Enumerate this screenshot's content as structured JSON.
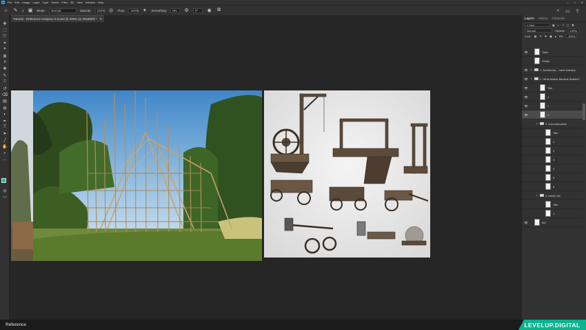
{
  "app": {
    "menu": [
      "File",
      "Edit",
      "Image",
      "Layer",
      "Type",
      "Select",
      "Filter",
      "3D",
      "View",
      "Window",
      "Help"
    ],
    "window_controls": [
      "–",
      "□",
      "✕"
    ]
  },
  "options_bar": {
    "brush_size": "1",
    "mode_label": "Mode:",
    "mode_value": "Normal",
    "opacity_label": "Opacity:",
    "opacity_value": "100%",
    "flow_label": "Flow:",
    "flow_value": "100%",
    "smoothing_label": "Smoothing:",
    "smoothing_value": "0%",
    "angle_value": "0°"
  },
  "document": {
    "tab_title": "Tutorial - Reference Analysys 2.0.psd @ 200% (3, RGB/8#) *",
    "close_glyph": "✕"
  },
  "colors": {
    "foreground": "#12c4a0",
    "background": "#ffffff",
    "brand": "#0bb38e"
  },
  "layers_panel": {
    "tabs": [
      "Layers",
      "History",
      "Channels"
    ],
    "filter_label": "Kind",
    "blend_mode": "Normal",
    "opacity_label": "Opacity:",
    "opacity_value": "100%",
    "lock_label": "Lock:",
    "fill_label": "Fill:",
    "fill_value": "100%",
    "layers": [
      {
        "name": "Topic",
        "kind": "thumb",
        "depth": 0,
        "visible": true,
        "selected": false
      },
      {
        "name": "Points",
        "kind": "thumb",
        "depth": 0,
        "visible": false,
        "selected": false
      },
      {
        "name": "1. Architectur... ment Industry",
        "kind": "folder",
        "depth": 0,
        "visible": true,
        "selected": false,
        "expanded": false
      },
      {
        "name": "2. What Makes Medical Stables?",
        "kind": "folder",
        "depth": 0,
        "visible": true,
        "selected": false,
        "expanded": true
      },
      {
        "name": "Title",
        "kind": "thumb",
        "depth": 1,
        "visible": true,
        "selected": false
      },
      {
        "name": "1",
        "kind": "thumb",
        "depth": 1,
        "visible": true,
        "selected": false
      },
      {
        "name": "2",
        "kind": "thumb",
        "depth": 1,
        "visible": true,
        "selected": false
      },
      {
        "name": "3",
        "kind": "thumb",
        "depth": 1,
        "visible": true,
        "selected": true
      },
      {
        "name": "3. Deconstruction",
        "kind": "folder",
        "depth": 1,
        "visible": false,
        "selected": false,
        "expanded": true
      },
      {
        "name": "Title",
        "kind": "thumb",
        "depth": 2,
        "visible": false,
        "selected": false
      },
      {
        "name": "1",
        "kind": "thumb",
        "depth": 2,
        "visible": false,
        "selected": false
      },
      {
        "name": "2",
        "kind": "thumb",
        "depth": 2,
        "visible": false,
        "selected": false
      },
      {
        "name": "3",
        "kind": "thumb",
        "depth": 2,
        "visible": false,
        "selected": false
      },
      {
        "name": "4",
        "kind": "thumb",
        "depth": 2,
        "visible": false,
        "selected": false
      },
      {
        "name": "5",
        "kind": "thumb",
        "depth": 2,
        "visible": false,
        "selected": false
      },
      {
        "name": "6",
        "kind": "thumb",
        "depth": 2,
        "visible": false,
        "selected": false
      },
      {
        "name": "4. Asset List",
        "kind": "folder",
        "depth": 1,
        "visible": false,
        "selected": false,
        "expanded": true
      },
      {
        "name": "Title",
        "kind": "thumb",
        "depth": 2,
        "visible": false,
        "selected": false
      },
      {
        "name": "1",
        "kind": "thumb",
        "depth": 2,
        "visible": false,
        "selected": false
      },
      {
        "name": "BG",
        "kind": "thumb",
        "depth": 0,
        "visible": true,
        "selected": false
      }
    ]
  },
  "status": {
    "caption": "Reference",
    "brand": "LEVELUP.DIGITAL"
  }
}
